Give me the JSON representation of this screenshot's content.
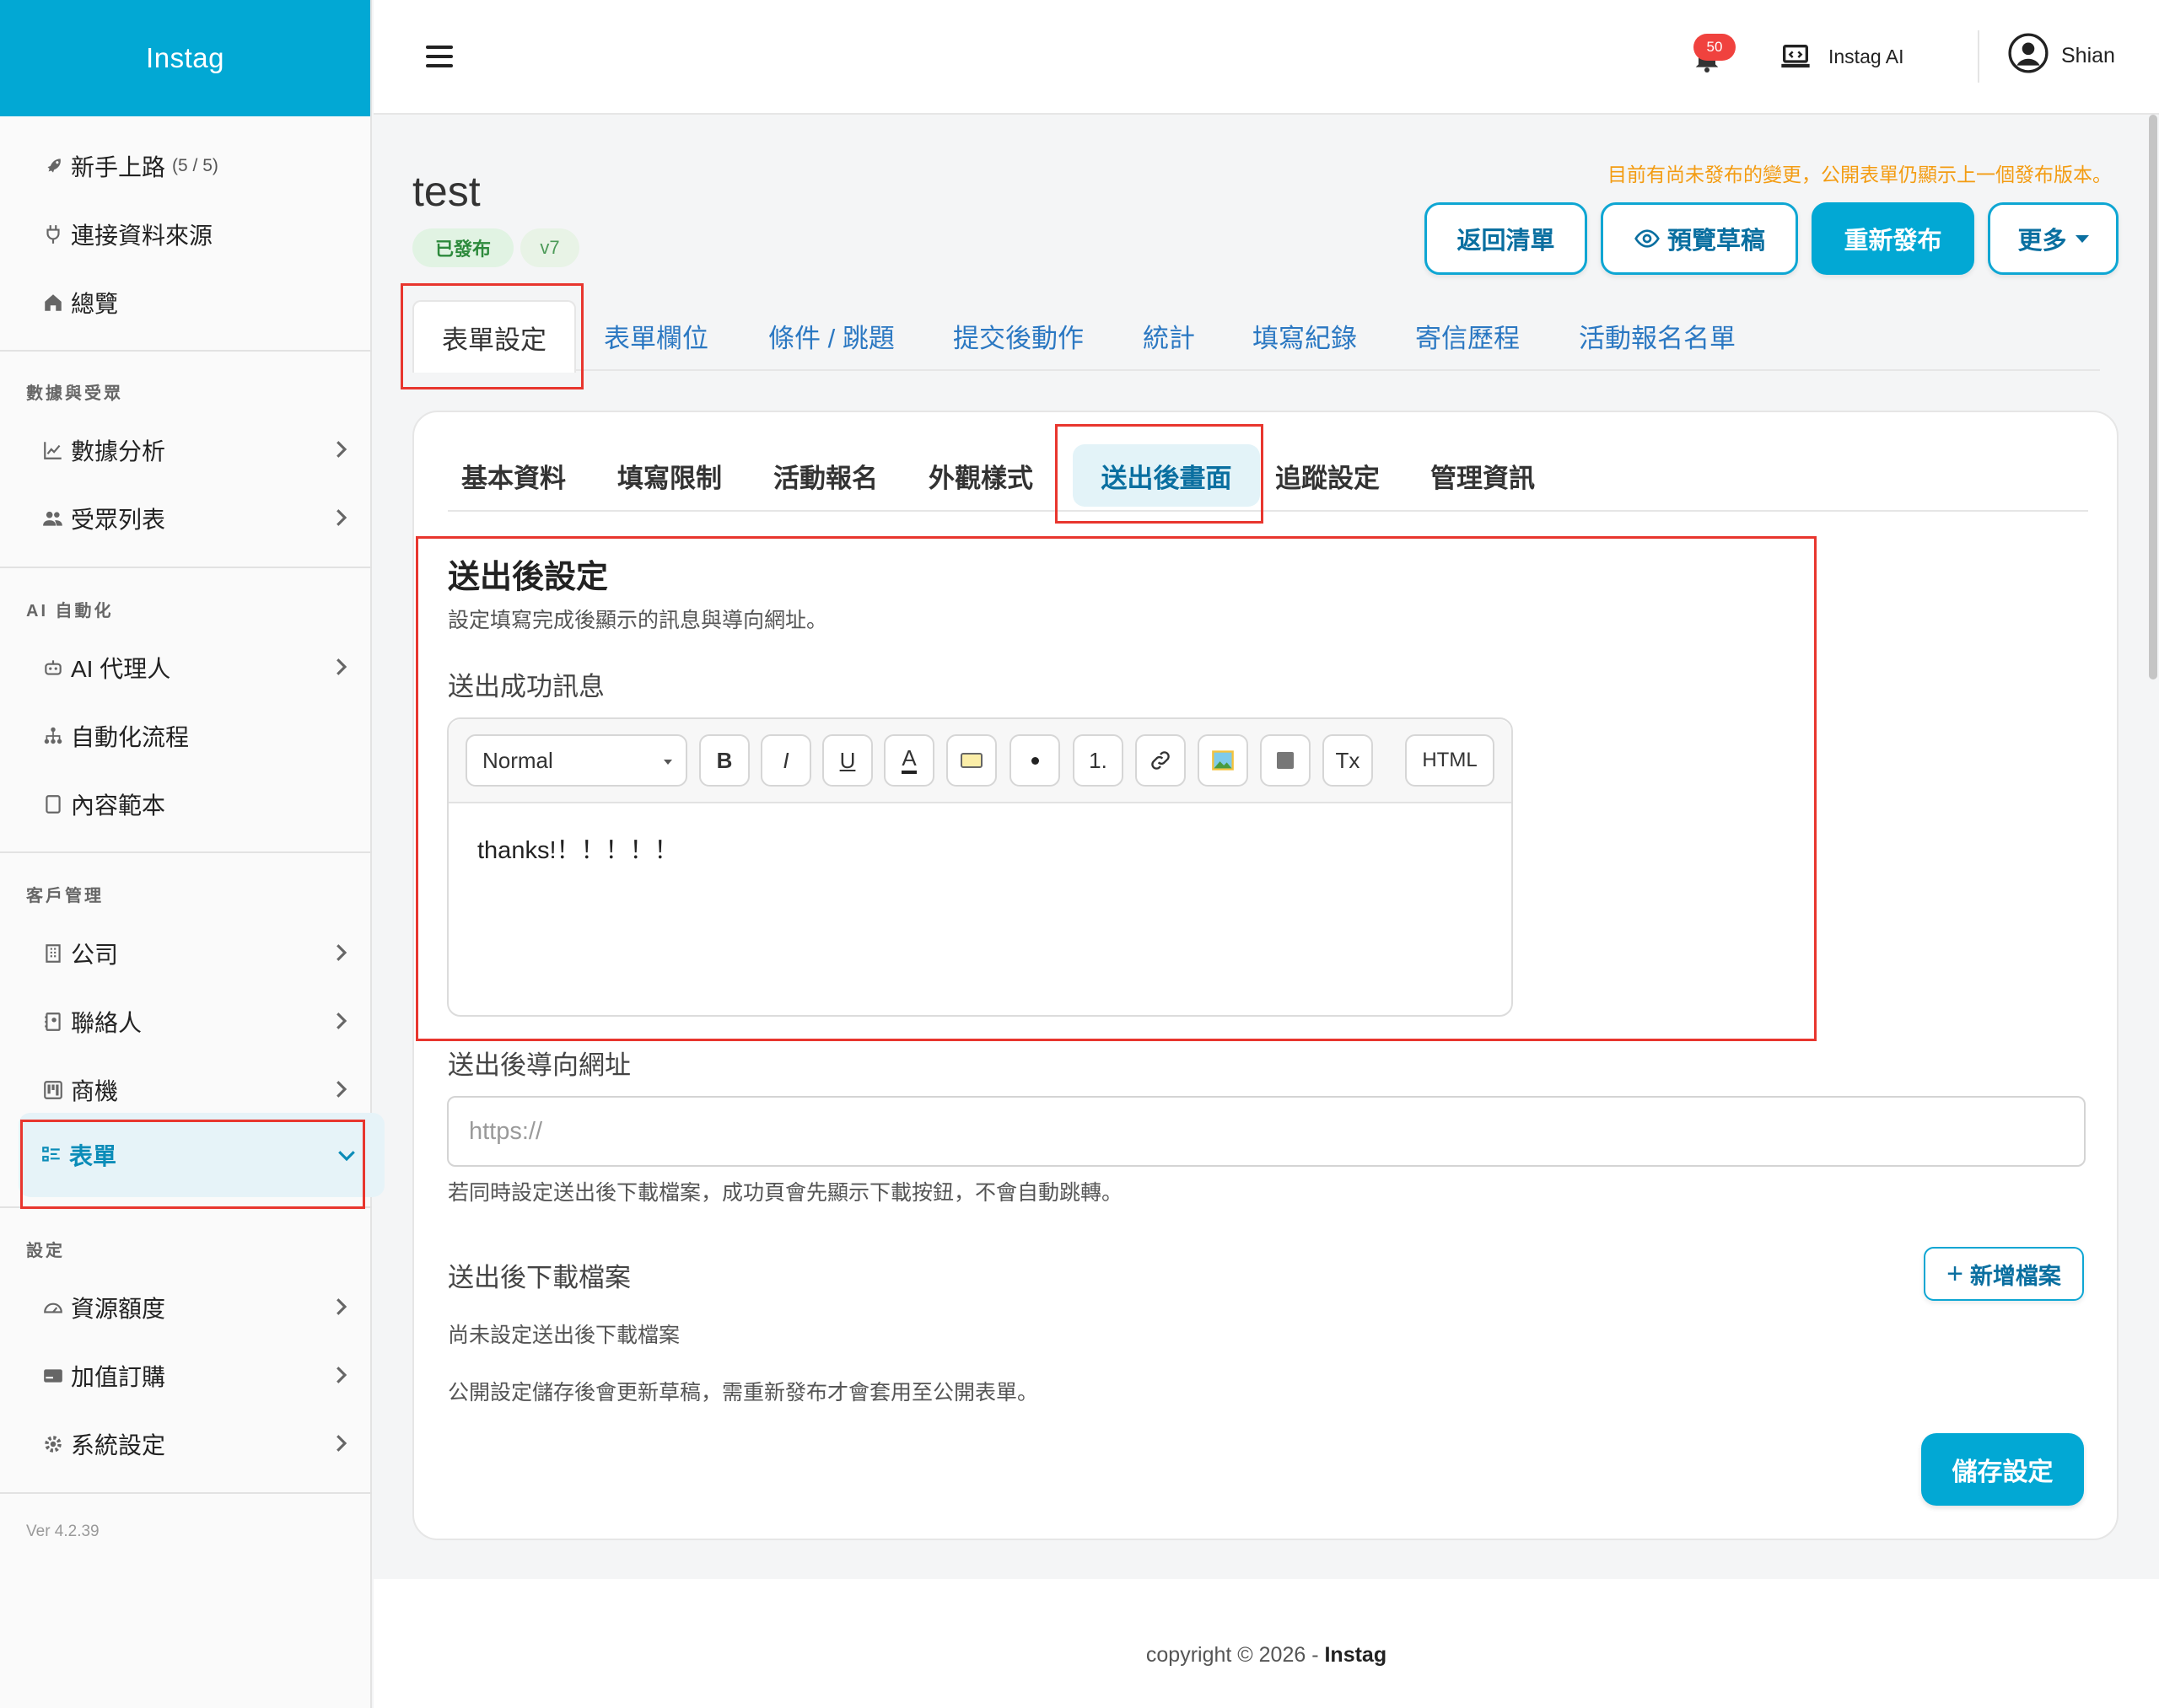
{
  "brand": "Instag",
  "sidebar": {
    "top_items": [
      {
        "label": "新手上路",
        "sub": "(5 / 5)",
        "icon": "rocket-icon"
      },
      {
        "label": "連接資料來源",
        "icon": "plug-icon"
      },
      {
        "label": "總覽",
        "icon": "home-icon"
      }
    ],
    "sections": [
      {
        "title": "數據與受眾",
        "items": [
          {
            "label": "數據分析",
            "icon": "chart-icon"
          },
          {
            "label": "受眾列表",
            "icon": "users-icon"
          }
        ]
      },
      {
        "title": "AI 自動化",
        "items": [
          {
            "label": "AI 代理人",
            "icon": "robot-icon"
          },
          {
            "label": "自動化流程",
            "icon": "flow-icon"
          },
          {
            "label": "內容範本",
            "icon": "template-icon"
          }
        ]
      },
      {
        "title": "客戶管理",
        "items": [
          {
            "label": "公司",
            "icon": "building-icon"
          },
          {
            "label": "聯絡人",
            "icon": "contact-book-icon"
          },
          {
            "label": "商機",
            "icon": "kanban-icon"
          },
          {
            "label": "表單",
            "icon": "form-list-icon"
          }
        ]
      },
      {
        "title": "設定",
        "items": [
          {
            "label": "資源額度",
            "icon": "gauge-icon"
          },
          {
            "label": "加值訂購",
            "icon": "card-icon"
          },
          {
            "label": "系統設定",
            "icon": "gear-icon"
          }
        ]
      }
    ],
    "version": "Ver 4.2.39"
  },
  "header": {
    "notification_count": "50",
    "ai_label": "Instag AI",
    "user_name": "Shian"
  },
  "page": {
    "title": "test",
    "status_badge": "已發布",
    "version_badge": "v7",
    "unpublished_note": "目前有尚未發布的變更，公開表單仍顯示上一個發布版本。",
    "buttons": {
      "back": "返回清單",
      "preview": "預覽草稿",
      "republish": "重新發布",
      "more": "更多"
    }
  },
  "main_tabs": [
    "表單設定",
    "表單欄位",
    "條件 / 跳題",
    "提交後動作",
    "統計",
    "填寫紀錄",
    "寄信歷程",
    "活動報名名單"
  ],
  "sub_tabs": [
    "基本資料",
    "填寫限制",
    "活動報名",
    "外觀樣式",
    "送出後畫面",
    "追蹤設定",
    "管理資訊"
  ],
  "section": {
    "title": "送出後設定",
    "description": "設定填寫完成後顯示的訊息與導向網址。",
    "success_label": "送出成功訊息",
    "editor": {
      "format": "Normal",
      "bold": "B",
      "italic": "I",
      "underline": "U",
      "color": "A",
      "ordered": "1.",
      "clear": "Tx",
      "html": "HTML",
      "content": "thanks!！！！！！"
    },
    "redirect_label": "送出後導向網址",
    "redirect_placeholder": "https://",
    "redirect_help": "若同時設定送出後下載檔案，成功頁會先顯示下載按鈕，不會自動跳轉。",
    "download_label": "送出後下載檔案",
    "add_file_button": "新增檔案",
    "no_file_text": "尚未設定送出後下載檔案",
    "publish_note": "公開設定儲存後會更新草稿，需重新發布才會套用至公開表單。",
    "save_button": "儲存設定"
  },
  "footer": {
    "text": "copyright © 2026 - ",
    "brand": "Instag"
  },
  "colors": {
    "brand": "#02a8d4",
    "link": "#2b78c2",
    "warning": "#f39c12",
    "highlight_box": "#e8362e"
  }
}
